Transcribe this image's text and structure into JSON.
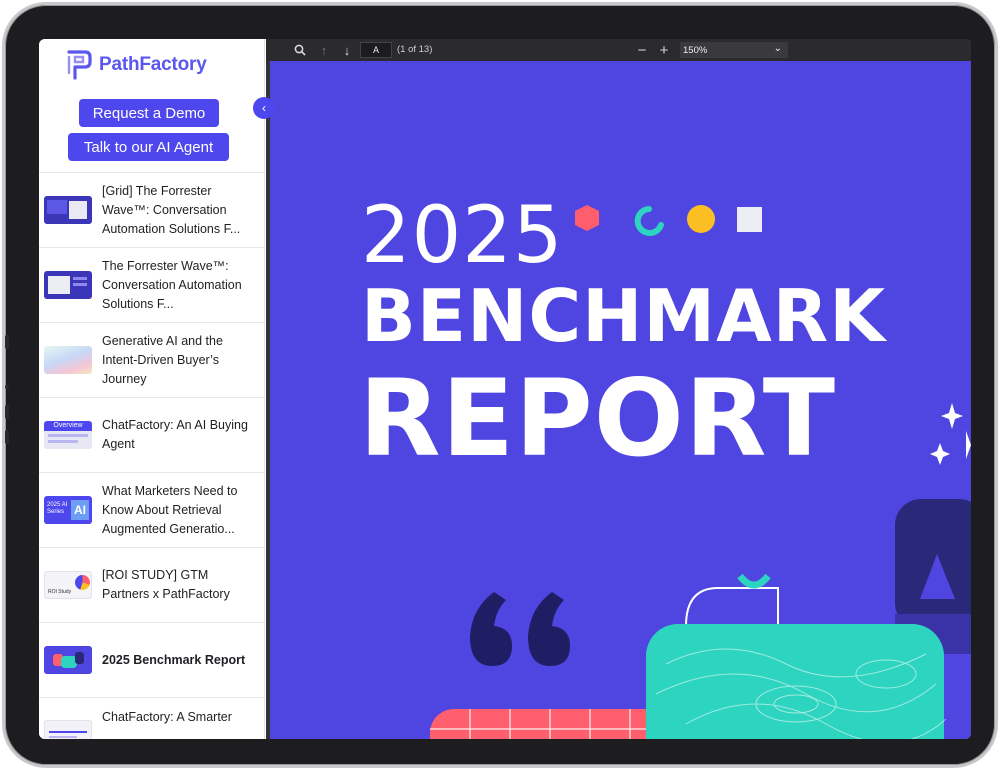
{
  "brand": {
    "name": "PathFactory",
    "accent": "#4d47ed"
  },
  "sidebar": {
    "buttons": {
      "demo": "Request a Demo",
      "agent": "Talk to our AI Agent"
    },
    "collapse_icon": "chevron-left-icon",
    "items": [
      {
        "title": "[Grid] The Forrester Wave™: Conversation Automation Solutions F...",
        "active": false
      },
      {
        "title": "The Forrester Wave™: Conversation Automation Solutions F...",
        "active": false
      },
      {
        "title": "Generative AI and the Intent-Driven Buyer’s Journey",
        "active": false
      },
      {
        "title": "ChatFactory: An AI Buying Agent",
        "active": false,
        "thumb_label": "Overview"
      },
      {
        "title": "What Marketers Need to Know About Retrieval Augmented Generatio...",
        "active": false,
        "thumb_label": "2025 AI Series"
      },
      {
        "title": "[ROI STUDY] GTM Partners x PathFactory",
        "active": false,
        "thumb_label": "ROI Study"
      },
      {
        "title": "2025 Benchmark Report",
        "active": true
      },
      {
        "title": "ChatFactory: A Smarter",
        "active": false
      }
    ]
  },
  "viewer": {
    "page_input": "A",
    "page_of": "(1 of 13)",
    "zoom": "150%"
  },
  "document": {
    "year": "2025",
    "line1": "BENCHMARK",
    "line2": "REPORT",
    "colors": {
      "background": "#4f45e0",
      "teal": "#2dd4bf",
      "coral": "#ff5f6d",
      "yellow": "#fbbf24",
      "navy": "#2a2878"
    }
  }
}
